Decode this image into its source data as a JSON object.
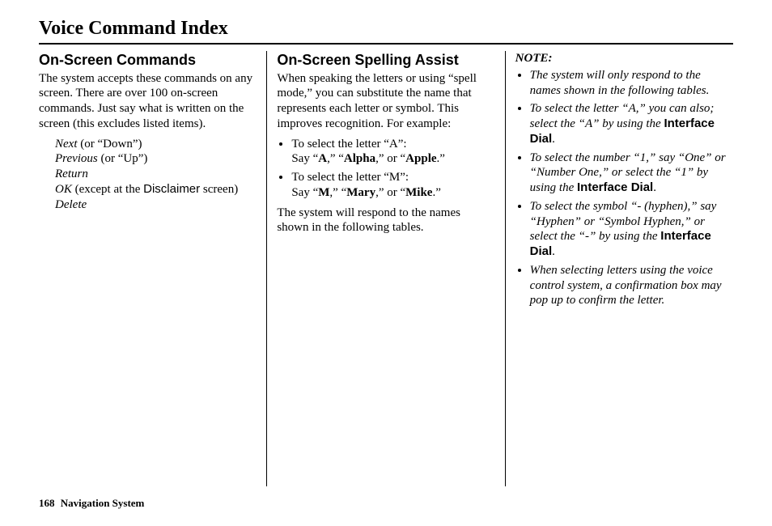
{
  "pageTitle": "Voice Command Index",
  "colLeft": {
    "heading": "On-Screen Commands",
    "intro": "The system accepts these commands on any screen. There are over 100 on-screen commands. Just say what is written on the screen (this excludes listed items).",
    "items": {
      "next": "Next",
      "nextAlt": " (or “Down”)",
      "previous": "Previous",
      "previousAlt": " (or “Up”)",
      "return": "Return",
      "ok": "OK",
      "okAlt1": " (except at the ",
      "okDisc": "Disclaimer",
      "okAlt2": " screen)",
      "delete": "Delete"
    }
  },
  "colMid": {
    "heading": "On-Screen Spelling Assist",
    "intro": "When speaking the letters or using “spell mode,” you can substitute the name that represents each letter or symbol. This improves recognition. For example:",
    "bulletA": {
      "lead": "To select the letter “A”:",
      "say": "Say “",
      "a1": "A",
      "sep1": ",” “",
      "a2": "Alpha",
      "sep2": ",” or “",
      "a3": "Apple",
      "end": ".”"
    },
    "bulletM": {
      "lead": "To select the letter “M”:",
      "say": "Say “",
      "m1": "M",
      "sep1": ",” “",
      "m2": "Mary",
      "sep2": ",” or “",
      "m3": "Mike",
      "end": ".”"
    },
    "outro": "The system will respond to the names shown in the following tables."
  },
  "colRight": {
    "noteHead": "NOTE:",
    "n1": "The system will only respond to the names shown in the following tables.",
    "n2a": "To select the letter “A,” you can also; select the “A” by using the ",
    "iface": "Interface Dial",
    "dot": ".",
    "n3a": "To select the number “1,” say “One” or “Number One,” or select the “1” by using the ",
    "n4a": "To select the symbol “- (hyphen),” say “Hyphen” or “Symbol Hyphen,” or select the “-” by using the ",
    "n5": "When selecting letters using the voice control system, a confirmation box may pop up to confirm the letter."
  },
  "footer": {
    "pageNum": "168",
    "label": "Navigation System"
  }
}
